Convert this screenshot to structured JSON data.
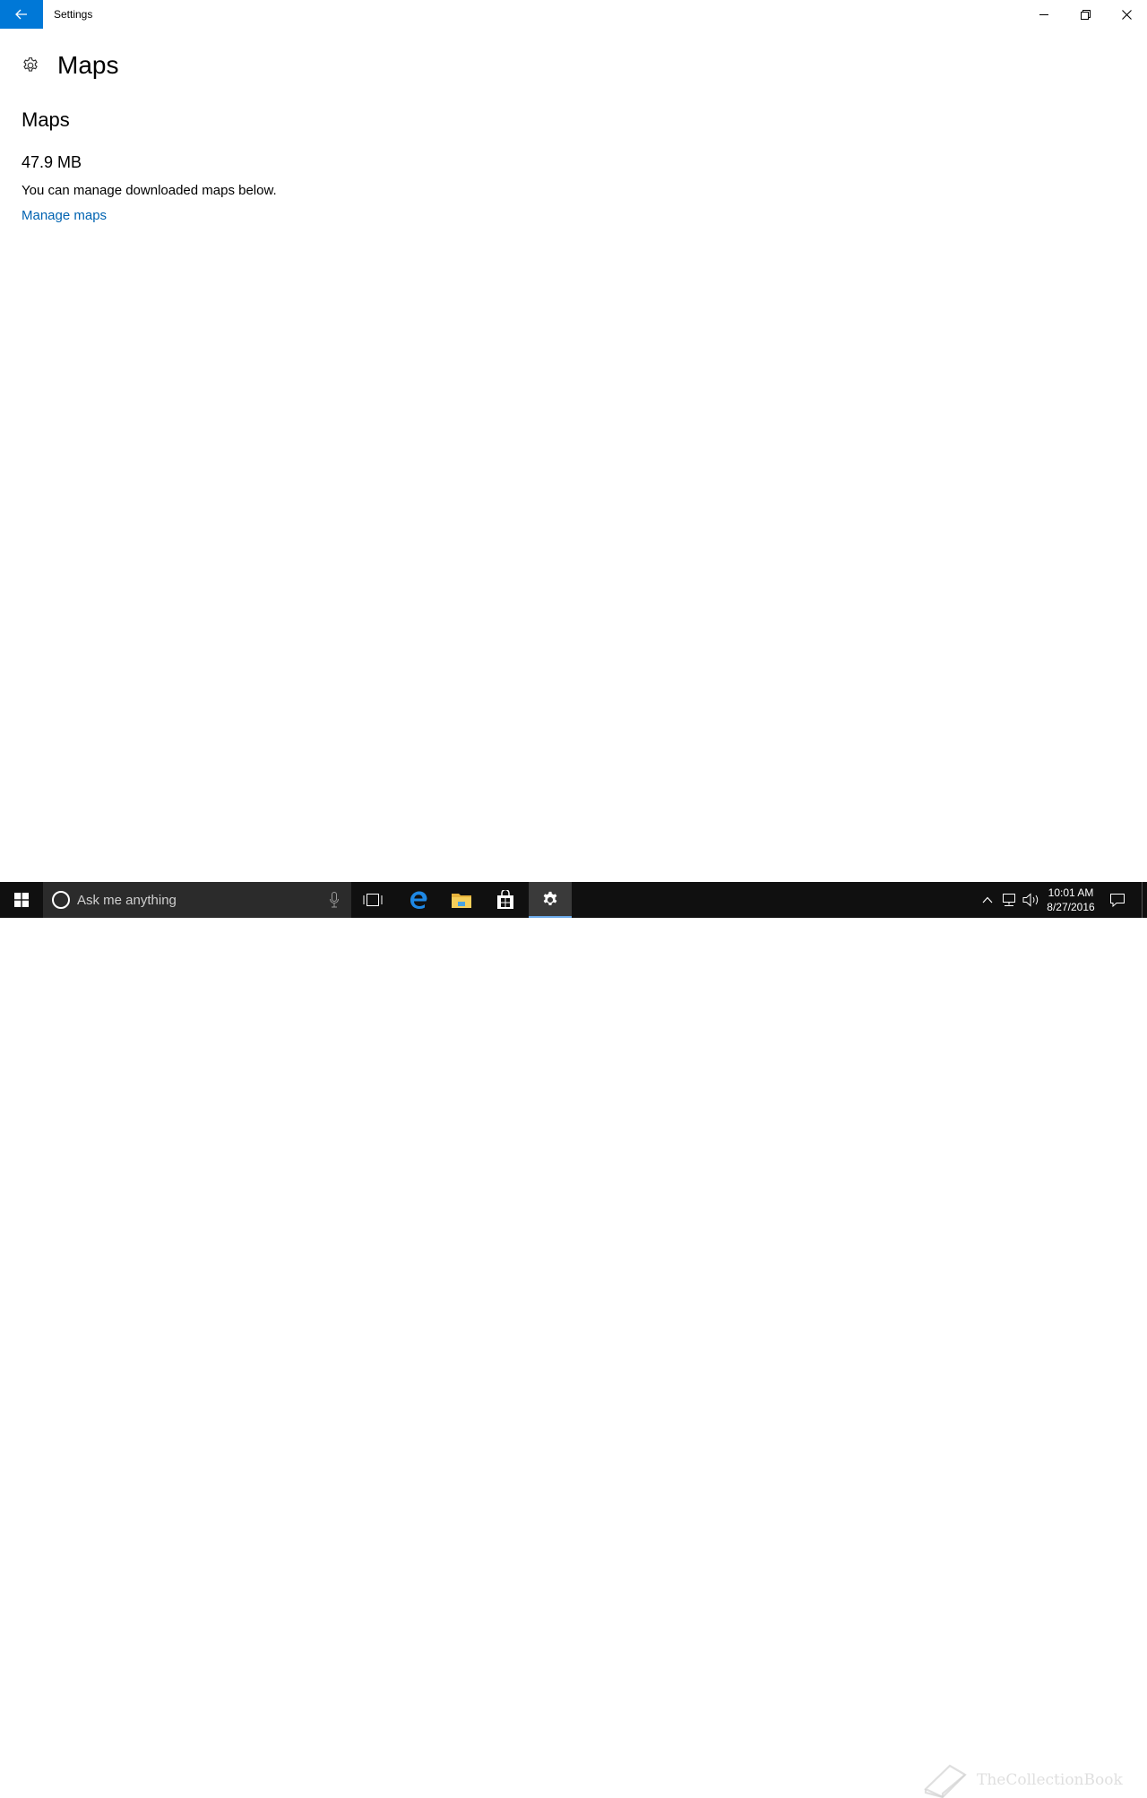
{
  "window": {
    "title": "Settings"
  },
  "page": {
    "header_title": "Maps",
    "section_title": "Maps",
    "storage_size": "47.9 MB",
    "description": "You can manage downloaded maps below.",
    "manage_link": "Manage maps"
  },
  "taskbar": {
    "search_placeholder": "Ask me anything",
    "pinned": [
      "task-view-icon",
      "edge-icon",
      "file-explorer-icon",
      "store-icon",
      "settings-icon"
    ],
    "active_app": "Settings",
    "clock_time": "10:01 AM",
    "clock_date": "8/27/2016"
  },
  "watermark": {
    "text": "TheCollectionBook"
  },
  "colors": {
    "accent": "#0078d7",
    "link": "#0063b1",
    "taskbar": "#101010",
    "search_box": "#2b2b2b"
  }
}
